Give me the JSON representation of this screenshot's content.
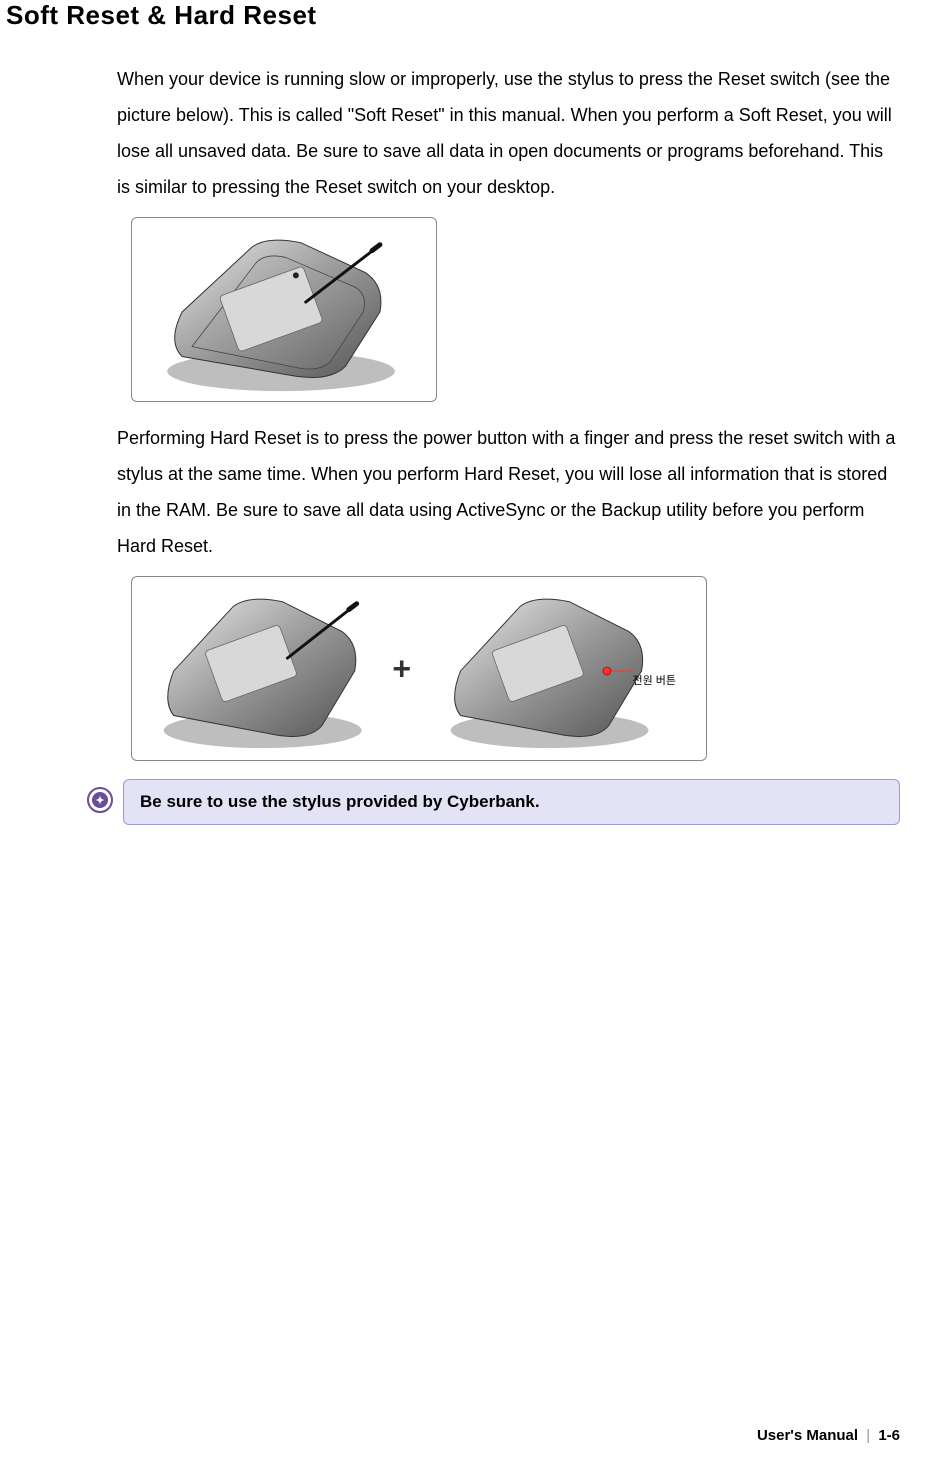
{
  "title": "Soft Reset & Hard Reset",
  "paragraph1": "When your device is running slow or improperly, use the stylus to press the Reset switch (see the picture below). This is called \"Soft Reset\" in this manual. When you perform a Soft Reset, you will lose all unsaved data. Be sure to save all data in open documents or programs beforehand. This is similar to pressing the Reset switch on your desktop.",
  "paragraph2": "Performing Hard Reset is to press the power button with a finger and press the reset switch with a stylus at the same time. When you perform Hard Reset, you will lose all information that is stored in the RAM. Be sure to save all data using ActiveSync or the Backup utility before you perform Hard Reset.",
  "callout_text": "Be sure to use the stylus provided by Cyberbank.",
  "figure2_label": "전원 버튼",
  "footer": {
    "label": "User's Manual",
    "divider": "|",
    "page": "1-6"
  }
}
